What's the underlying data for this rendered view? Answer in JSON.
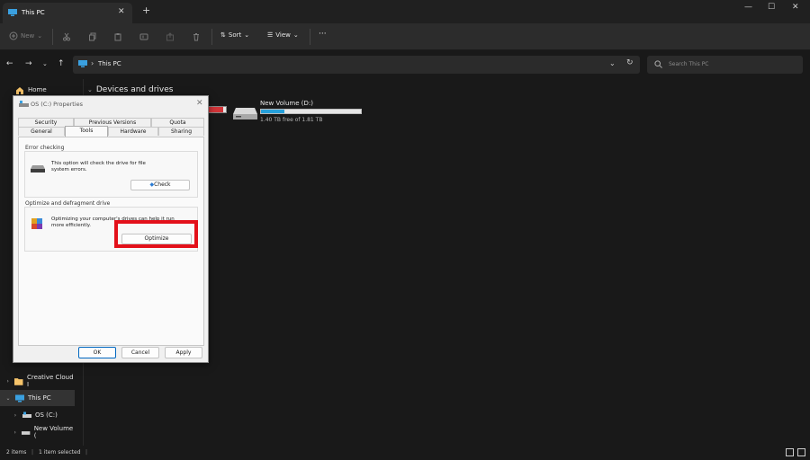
{
  "window": {
    "tab_title": "This PC",
    "new_tab": "+",
    "close_tab": "✕",
    "minimize": "—",
    "maximize": "☐",
    "close": "✕"
  },
  "toolbar": {
    "new_label": "New",
    "sort_label": "Sort",
    "view_label": "View",
    "more_label": "···"
  },
  "address": {
    "location": "This PC",
    "search_placeholder": "Search This PC"
  },
  "nav": {
    "home": "Home",
    "creative_cloud": "Creative Cloud I",
    "this_pc": "This PC",
    "os_c": "OS (C:)",
    "new_volume": "New Volume ("
  },
  "main": {
    "section_title": "Devices and drives",
    "drive_c_used_fraction": 0.85,
    "drive_d": {
      "name": "New Volume (D:)",
      "free_text": "1.40 TB free of 1.81 TB",
      "used_fraction": 0.23
    }
  },
  "status": {
    "items": "2 items",
    "selected": "1 item selected"
  },
  "dialog": {
    "title": "OS (C:) Properties",
    "close": "✕",
    "tabs_top": [
      "Security",
      "Previous Versions",
      "Quota"
    ],
    "tabs_bottom": [
      "General",
      "Tools",
      "Hardware",
      "Sharing"
    ],
    "active_tab": "Tools",
    "error_checking": {
      "label": "Error checking",
      "description": "This option will check the drive for file system errors.",
      "button": "Check"
    },
    "optimize": {
      "label": "Optimize and defragment drive",
      "description": "Optimizing your computer's drives can help it run more efficiently.",
      "button": "Optimize"
    },
    "buttons": {
      "ok": "OK",
      "cancel": "Cancel",
      "apply": "Apply"
    }
  },
  "colors": {
    "accent": "#26a0da",
    "highlight": "#e3101a",
    "drive_full": "#d13438"
  }
}
